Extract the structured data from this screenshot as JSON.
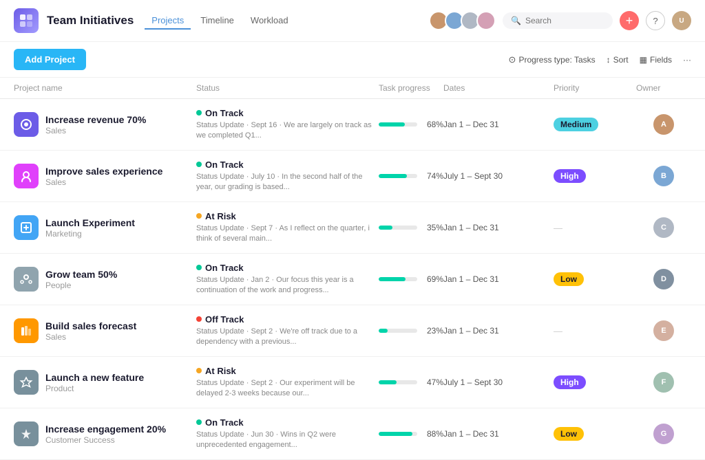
{
  "app": {
    "icon_bg": "#6c5ce7",
    "title": "Team Initiatives",
    "nav": {
      "tabs": [
        {
          "label": "Projects",
          "active": true
        },
        {
          "label": "Timeline",
          "active": false
        },
        {
          "label": "Workload",
          "active": false
        }
      ]
    }
  },
  "toolbar": {
    "add_project_label": "Add Project",
    "progress_type_label": "Progress type: Tasks",
    "sort_label": "Sort",
    "fields_label": "Fields"
  },
  "table": {
    "columns": [
      "Project name",
      "Status",
      "Task progress",
      "Dates",
      "Priority",
      "Owner"
    ],
    "rows": [
      {
        "id": 1,
        "icon_bg": "#6c5ce7",
        "name": "Increase revenue 70%",
        "category": "Sales",
        "status": "On Track",
        "status_type": "green",
        "description": "Status Update · Sept 16 · We are largely on track as we completed Q1...",
        "progress": 68,
        "dates": "Jan 1 – Dec 31",
        "priority": "Medium",
        "priority_type": "medium"
      },
      {
        "id": 2,
        "icon_bg": "#e040fb",
        "name": "Improve sales experience",
        "category": "Sales",
        "status": "On Track",
        "status_type": "green",
        "description": "Status Update · July 10 · In the second half of the year, our grading is based...",
        "progress": 74,
        "dates": "July 1 – Sept 30",
        "priority": "High",
        "priority_type": "high"
      },
      {
        "id": 3,
        "icon_bg": "#42a5f5",
        "name": "Launch Experiment",
        "category": "Marketing",
        "status": "At Risk",
        "status_type": "orange",
        "description": "Status Update · Sept 7 · As I reflect on the quarter, i think of several main...",
        "progress": 35,
        "dates": "Jan 1 – Dec 31",
        "priority": "—",
        "priority_type": "none"
      },
      {
        "id": 4,
        "icon_bg": "#90a4ae",
        "name": "Grow team 50%",
        "category": "People",
        "status": "On Track",
        "status_type": "green",
        "description": "Status Update · Jan 2 · Our focus this year is a continuation of the work and progress...",
        "progress": 69,
        "dates": "Jan 1 – Dec 31",
        "priority": "Low",
        "priority_type": "low"
      },
      {
        "id": 5,
        "icon_bg": "#ff9800",
        "name": "Build sales forecast",
        "category": "Sales",
        "status": "Off Track",
        "status_type": "red",
        "description": "Status Update · Sept 2 · We're off track due to a dependency with a previous...",
        "progress": 23,
        "dates": "Jan 1 – Dec 31",
        "priority": "—",
        "priority_type": "none"
      },
      {
        "id": 6,
        "icon_bg": "#78909c",
        "name": "Launch a new feature",
        "category": "Product",
        "status": "At Risk",
        "status_type": "orange",
        "description": "Status Update · Sept 2 · Our experiment will be delayed 2-3 weeks because our...",
        "progress": 47,
        "dates": "July 1 – Sept 30",
        "priority": "High",
        "priority_type": "high"
      },
      {
        "id": 7,
        "icon_bg": "#78909c",
        "name": "Increase engagement 20%",
        "category": "Customer Success",
        "status": "On Track",
        "status_type": "green",
        "description": "Status Update · Jun 30 · Wins in Q2 were unprecedented engagement...",
        "progress": 88,
        "dates": "Jan 1 – Dec 31",
        "priority": "Low",
        "priority_type": "low"
      }
    ]
  },
  "icons": {
    "search": "🔍",
    "add": "+",
    "help": "?",
    "more": "···",
    "progress_type": "⊙",
    "sort": "↕",
    "fields": "▦"
  }
}
